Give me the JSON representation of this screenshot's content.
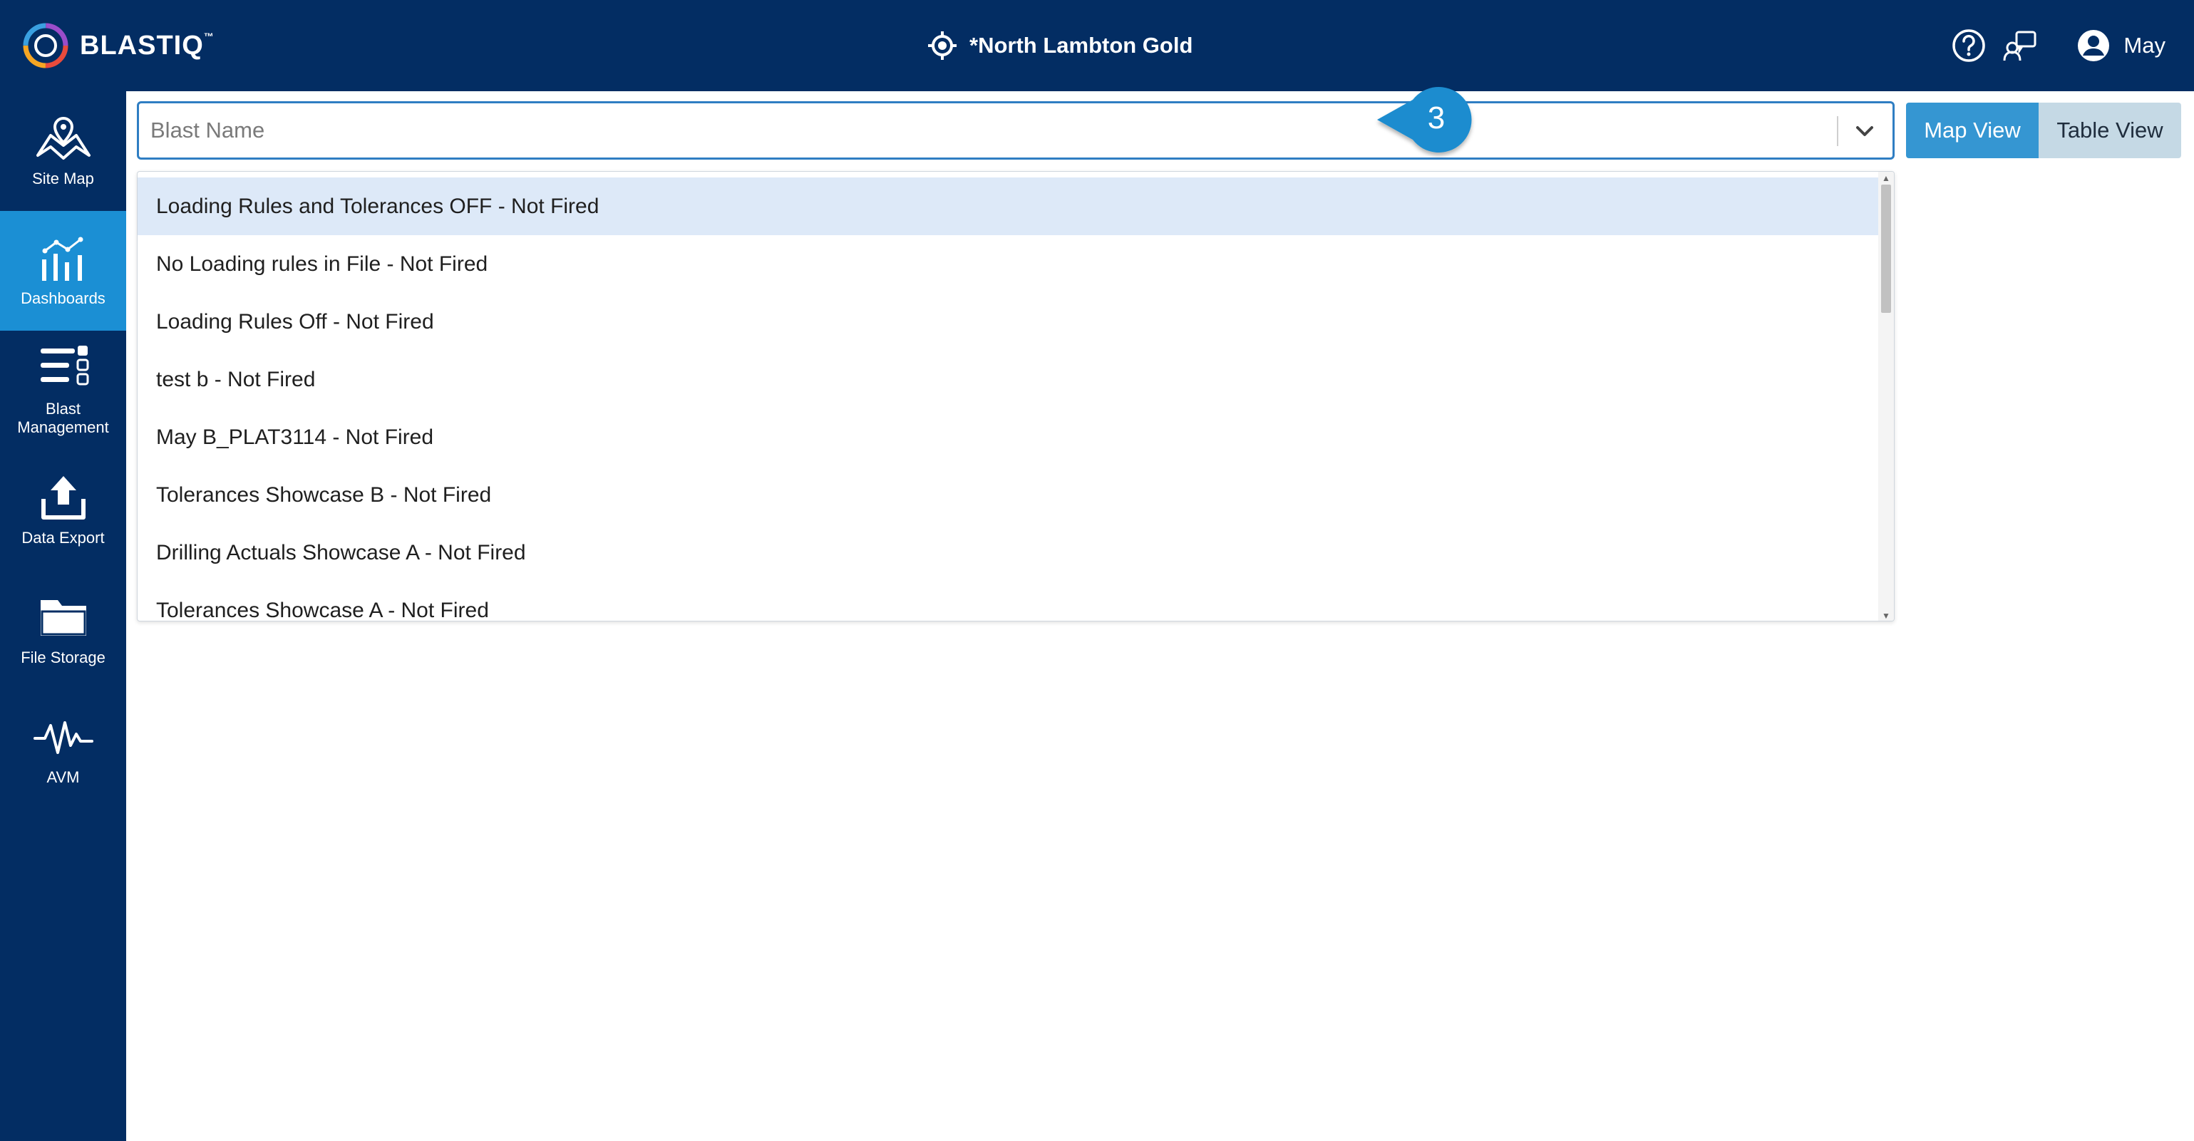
{
  "app": {
    "logo_text": "BLAST",
    "logo_suffix": "IQ",
    "logo_tm": "™"
  },
  "header": {
    "site_name": "*North Lambton Gold",
    "user_name": "May",
    "icons": [
      "crosshair-icon",
      "help-icon",
      "support-icon",
      "user-icon"
    ]
  },
  "sidebar": {
    "items": [
      {
        "label": "Site Map",
        "icon": "site-map-icon",
        "active": false
      },
      {
        "label": "Dashboards",
        "icon": "dashboards-icon",
        "active": true
      },
      {
        "label": "Blast\nManagement",
        "icon": "blast-management-icon",
        "active": false
      },
      {
        "label": "Data Export",
        "icon": "data-export-icon",
        "active": false
      },
      {
        "label": "File Storage",
        "icon": "file-storage-icon",
        "active": false
      },
      {
        "label": "AVM",
        "icon": "avm-icon",
        "active": false
      }
    ]
  },
  "search": {
    "placeholder": "Blast Name",
    "value": ""
  },
  "callout": {
    "step": "3",
    "color": "#1a8ccf"
  },
  "view_toggle": {
    "map_label": "Map View",
    "table_label": "Table View",
    "selected": "Map View"
  },
  "dropdown": {
    "options": [
      "Loading Rules and Tolerances OFF - Not Fired",
      "No Loading rules in File - Not Fired",
      "Loading Rules Off - Not Fired",
      "test b - Not Fired",
      "May B_PLAT3114 - Not Fired",
      "Tolerances Showcase B - Not Fired",
      "Drilling Actuals Showcase A - Not Fired",
      "Tolerances Showcase A - Not Fired"
    ],
    "highlighted_index": 0
  },
  "colors": {
    "nav_bg": "#032d63",
    "active_nav": "#1b8fd4",
    "accent": "#3596d2",
    "highlight_row": "#dde9f8"
  }
}
